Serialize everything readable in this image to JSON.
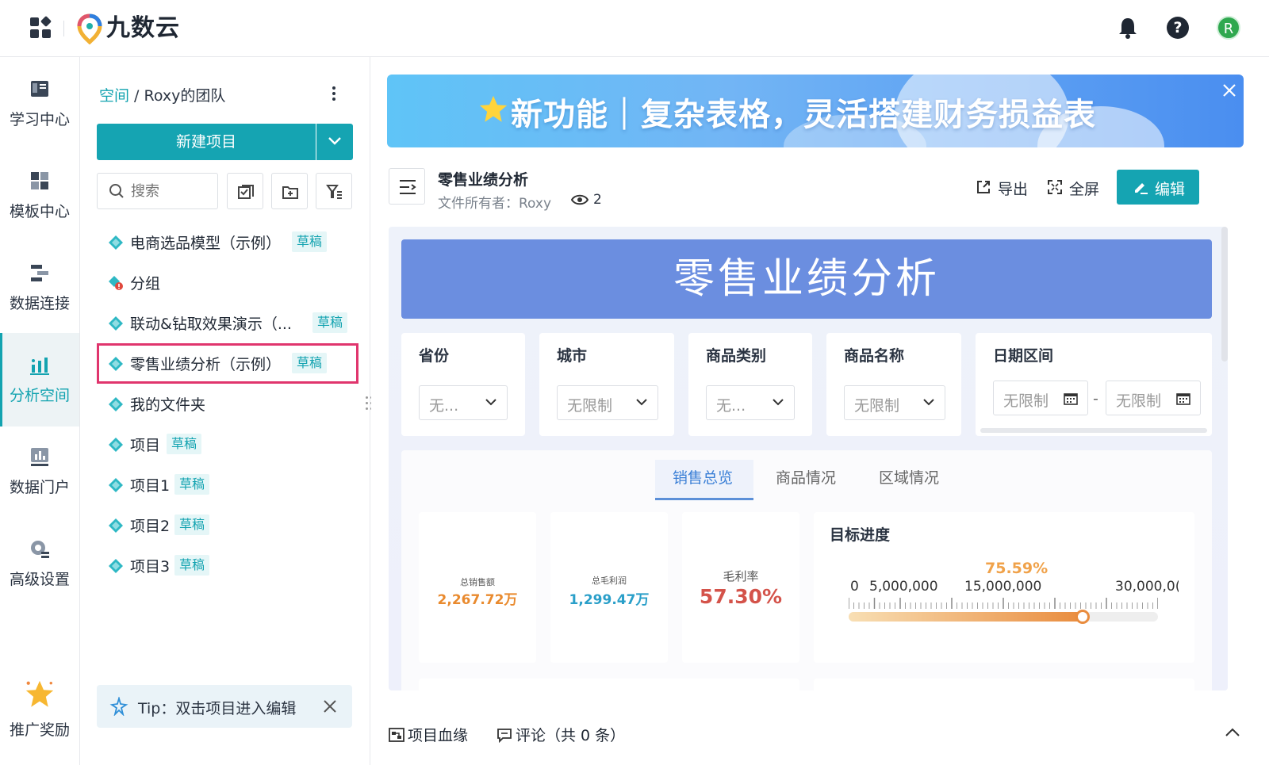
{
  "app": {
    "brand": "九数云"
  },
  "rail": {
    "items": [
      {
        "label": "学习中心",
        "icon": "book-icon"
      },
      {
        "label": "模板中心",
        "icon": "template-icon"
      },
      {
        "label": "数据连接",
        "icon": "data-connect-icon"
      },
      {
        "label": "分析空间",
        "icon": "analysis-icon",
        "active": true
      },
      {
        "label": "数据门户",
        "icon": "portal-icon"
      },
      {
        "label": "高级设置",
        "icon": "gear-icon"
      },
      {
        "label": "推广奖励",
        "icon": "star-icon"
      }
    ]
  },
  "panel": {
    "breadcrumb_root": "空间",
    "breadcrumb_sep": " / ",
    "breadcrumb_team": "Roxy的团队",
    "new_project": "新建项目",
    "search_placeholder": "搜索",
    "projects": [
      {
        "name": "电商选品模型（示例）",
        "tag": "草稿"
      },
      {
        "name": "分组",
        "tag": ""
      },
      {
        "name": "联动&钻取效果演示（...",
        "tag": "草稿"
      },
      {
        "name": "零售业绩分析（示例）",
        "tag": "草稿",
        "selected": true
      },
      {
        "name": "我的文件夹",
        "tag": ""
      },
      {
        "name": "项目",
        "tag": "草稿"
      },
      {
        "name": "项目1",
        "tag": "草稿"
      },
      {
        "name": "项目2",
        "tag": "草稿"
      },
      {
        "name": "项目3",
        "tag": "草稿"
      }
    ],
    "tip": "Tip：双击项目进入编辑"
  },
  "banner": {
    "text": "新功能｜复杂表格，灵活搭建财务损益表"
  },
  "doc": {
    "title": "零售业绩分析",
    "owner": "文件所有者：Roxy",
    "views": "2",
    "export": "导出",
    "fullscreen": "全屏",
    "edit": "编辑"
  },
  "dashboard": {
    "title": "零售业绩分析",
    "filters": [
      {
        "label": "省份",
        "value": "无..."
      },
      {
        "label": "城市",
        "value": "无限制"
      },
      {
        "label": "商品类别",
        "value": "无..."
      },
      {
        "label": "商品名称",
        "value": "无限制"
      }
    ],
    "date_filter": {
      "label": "日期区间",
      "start": "无限制",
      "sep": "-",
      "end": "无限制"
    },
    "tabs": [
      "销售总览",
      "商品情况",
      "区域情况"
    ],
    "active_tab": 0,
    "kpis": [
      {
        "label": "总销售额",
        "value": "2,267.72万",
        "color": "#e98a2e"
      },
      {
        "label": "总毛利润",
        "value": "1,299.47万",
        "color": "#2a9fc9"
      },
      {
        "label": "毛利率",
        "value": "57.30%",
        "color": "#d4534a"
      }
    ],
    "goal": {
      "title": "目标进度",
      "percent_label": "75.59%",
      "progress": 0.7559,
      "ticks": [
        "0",
        "5,000,000",
        "15,000,000",
        "30,000,0("
      ]
    }
  },
  "footer": {
    "lineage": "项目血缘",
    "comments": "评论（共 0 条）"
  },
  "colors": {
    "accent": "#15a4b2",
    "highlight": "#e0356d",
    "dash_title": "#6b8ee0"
  }
}
